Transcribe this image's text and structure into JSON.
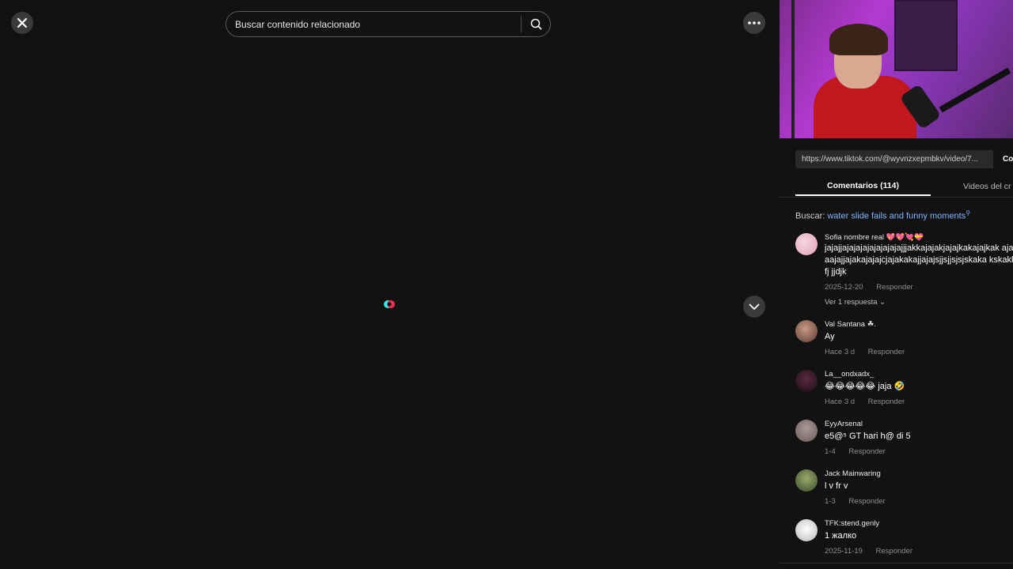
{
  "search": {
    "placeholder": "Buscar contenido relacionado"
  },
  "panel": {
    "url": "https://www.tiktok.com/@wyvnzxepmbkv/video/7...",
    "copy_label": "Co",
    "tabs": [
      {
        "label": "Comentarios (114)"
      },
      {
        "label": "Videos del cr"
      }
    ],
    "related": {
      "prefix": "Buscar:",
      "term": "water slide fails and funny moments"
    },
    "comments": [
      {
        "user": "Sofia nombre real 💖💖💘💝",
        "text": "jajajjajajajajajajajajajjjakkajajakjajajkakajajkak ajajjahaajajjajakajajajcjajakakajjajajsjjsjjsjsjskaka kskakkjsjjfjfj jjdjk",
        "date": "2025-12-20",
        "reply": "Responder",
        "replies": "Ver 1 respuesta ⌄",
        "avatar_color": "#e9b8c8"
      },
      {
        "user": "Val Santana ☘.",
        "text": "Ay",
        "date": "Hace 3 d",
        "reply": "Responder",
        "avatar_color": "#8a6a5a"
      },
      {
        "user": "La__ondxadx_",
        "text": "😂😂😂😂😂 jaja 🤣",
        "date": "Hace 3 d",
        "reply": "Responder",
        "avatar_color": "#2a1a22"
      },
      {
        "user": "EyyArsenal",
        "text": "e5@⁵ GT hari h@ di 5",
        "date": "1-4",
        "reply": "Responder",
        "avatar_color": "#8a7a78"
      },
      {
        "user": "Jack Mainwaring",
        "text": "l v fr v",
        "date": "1-3",
        "reply": "Responder",
        "avatar_color": "#6a7a4a"
      },
      {
        "user": "TFK:stend.genly",
        "text": "1 жалко",
        "date": "2025-11-19",
        "reply": "Responder",
        "avatar_color": "#d8d8d8"
      }
    ]
  },
  "colors": {
    "background": "#121212",
    "link": "#7fb6ff",
    "spinner_red": "#fe2c55",
    "spinner_cyan": "#25f4ee"
  }
}
